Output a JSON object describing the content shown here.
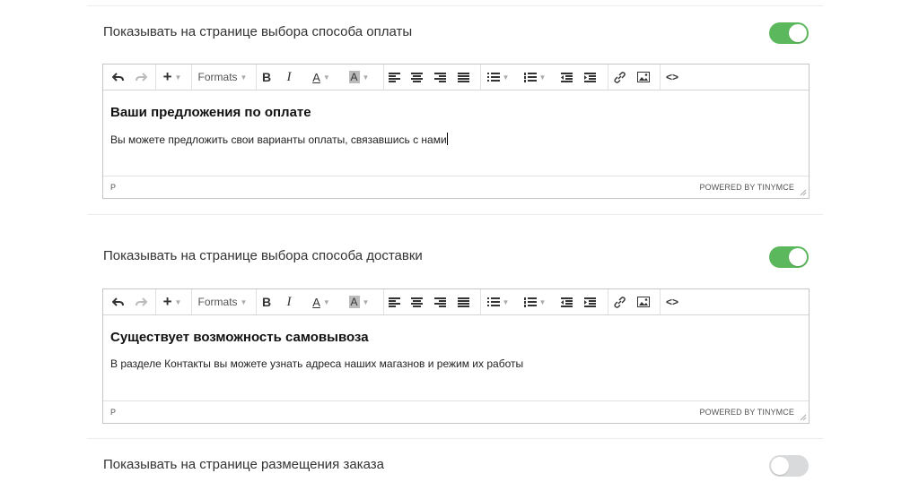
{
  "sections": [
    {
      "label": "Показывать на странице выбора способа оплаты",
      "enabled": true,
      "heading": "Ваши предложения по оплате",
      "paragraph": "Вы можете предложить свои варианты оплаты, связавшись с нами",
      "status_path": "P",
      "powered_by": "POWERED BY TINYMCE"
    },
    {
      "label": "Показывать на странице выбора способа доставки",
      "enabled": true,
      "heading": "Существует возможность самовывоза",
      "paragraph": "В разделе Контакты вы можете узнать адреса наших магазнов и режим их работы",
      "status_path": "P",
      "powered_by": "POWERED BY TINYMCE"
    },
    {
      "label": "Показывать на странице размещения заказа",
      "enabled": false
    }
  ],
  "toolbar": {
    "formats_label": "Formats",
    "bold_label": "B",
    "italic_label": "I",
    "font_color_label": "A",
    "bg_color_label": "A",
    "code_label": "<>"
  },
  "colors": {
    "toggle_on": "#5cb85c",
    "toggle_off": "#d9dadb"
  }
}
